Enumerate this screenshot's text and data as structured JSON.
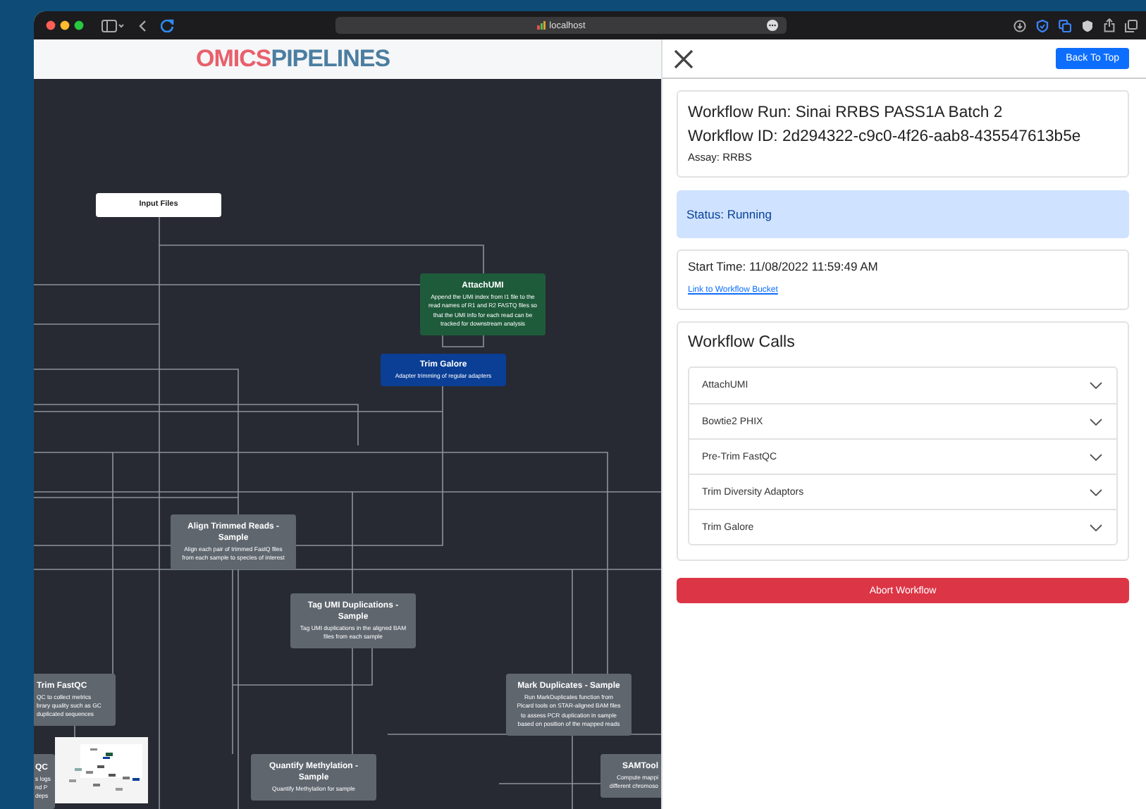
{
  "browser": {
    "address": "localhost"
  },
  "header": {
    "logo": [
      {
        "text": "OMICS",
        "color": "#e8606b"
      },
      {
        "text": "PIPELINES",
        "color": "#4b7ea1"
      }
    ]
  },
  "diagram": {
    "nodes": [
      {
        "kind": "input",
        "title": "Input Files"
      },
      {
        "kind": "step",
        "color": "#1e5b3b",
        "title": "AttachUMI",
        "description": [
          "Append the UMI index from I1 file to the",
          "read names of R1 and R2 FASTQ files so",
          "that the UMI info for each read can be",
          "tracked for downstream analysis"
        ]
      },
      {
        "kind": "step",
        "color": "#0b3f96",
        "title": "Trim Galore",
        "description": [
          "Adapter trimming of regular adapters"
        ]
      },
      {
        "kind": "step",
        "color": "#5f666e",
        "title": "Align Trimmed Reads - Sample",
        "description": [
          "Align each pair of trimmed FastQ files",
          "from each sample to species of interest"
        ]
      },
      {
        "kind": "step",
        "color": "#5f666e",
        "title": "Tag UMI Duplications - Sample",
        "description": [
          "Tag UMI duplications in the aligned BAM",
          "files from each sample"
        ]
      },
      {
        "kind": "step",
        "color": "#5f666e",
        "title": "Trim FastQC",
        "description": [
          "QC to collect metrics",
          "brary quality such as GC",
          "duplicated sequences"
        ]
      },
      {
        "kind": "step",
        "color": "#5f666e",
        "title": "Mark Duplicates - Sample",
        "description": [
          "Run MarkDuplicates function from",
          "Picard tools on STAR-aligned BAM files",
          "to assess PCR duplication in sample",
          "based on position of the mapped reads"
        ]
      },
      {
        "kind": "step",
        "color": "#5f666e",
        "title": "QC",
        "description": [
          "s logs",
          "nd P",
          "deps"
        ]
      },
      {
        "kind": "step",
        "color": "#5f666e",
        "title": "Quantify Methylation - Sample",
        "description": [
          "Quantify Methylation for sample"
        ]
      },
      {
        "kind": "step",
        "color": "#5f666e",
        "title": "SAMTool",
        "description": [
          "Compute mappi",
          "different chromoso"
        ]
      }
    ]
  },
  "panel": {
    "back_button": "Back To Top",
    "run": {
      "name": "Workflow Run: Sinai RRBS PASS1A Batch 2",
      "id": "Workflow ID: 2d294322-c9c0-4f26-aab8-435547613b5e",
      "assay": "Assay: RRBS"
    },
    "status": "Status: Running",
    "start_time": "Start Time: 11/08/2022 11:59:49 AM",
    "bucket_link": "Link to Workflow Bucket",
    "calls_title": "Workflow Calls",
    "calls": [
      {
        "label": "AttachUMI",
        "expanded": false
      },
      {
        "label": "Bowtie2 PHIX",
        "expanded": false
      },
      {
        "label": "Pre-Trim FastQC",
        "expanded": false
      },
      {
        "label": "Trim Diversity Adaptors",
        "expanded": false
      },
      {
        "label": "Trim Galore",
        "expanded": false
      }
    ],
    "abort_button": "Abort Workflow"
  }
}
